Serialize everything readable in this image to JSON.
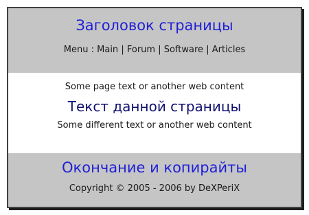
{
  "header": {
    "title": "Заголовок страницы",
    "menu_label": "Menu :",
    "separator": "|",
    "menu_items": [
      {
        "label": "Main"
      },
      {
        "label": "Forum"
      },
      {
        "label": "Software"
      },
      {
        "label": "Articles"
      }
    ]
  },
  "content": {
    "text_top": "Some page text or another web content",
    "title": "Текст данной страницы",
    "text_bottom": "Some different text or another web content"
  },
  "footer": {
    "title": "Окончание и копирайты",
    "copyright": "Copyright © 2005 - 2006 by DeXPeriX"
  },
  "colors": {
    "band_background": "#c5c5c5",
    "heading_blue": "#1f1fd8",
    "content_title_navy": "#101070",
    "border": "#404040"
  }
}
